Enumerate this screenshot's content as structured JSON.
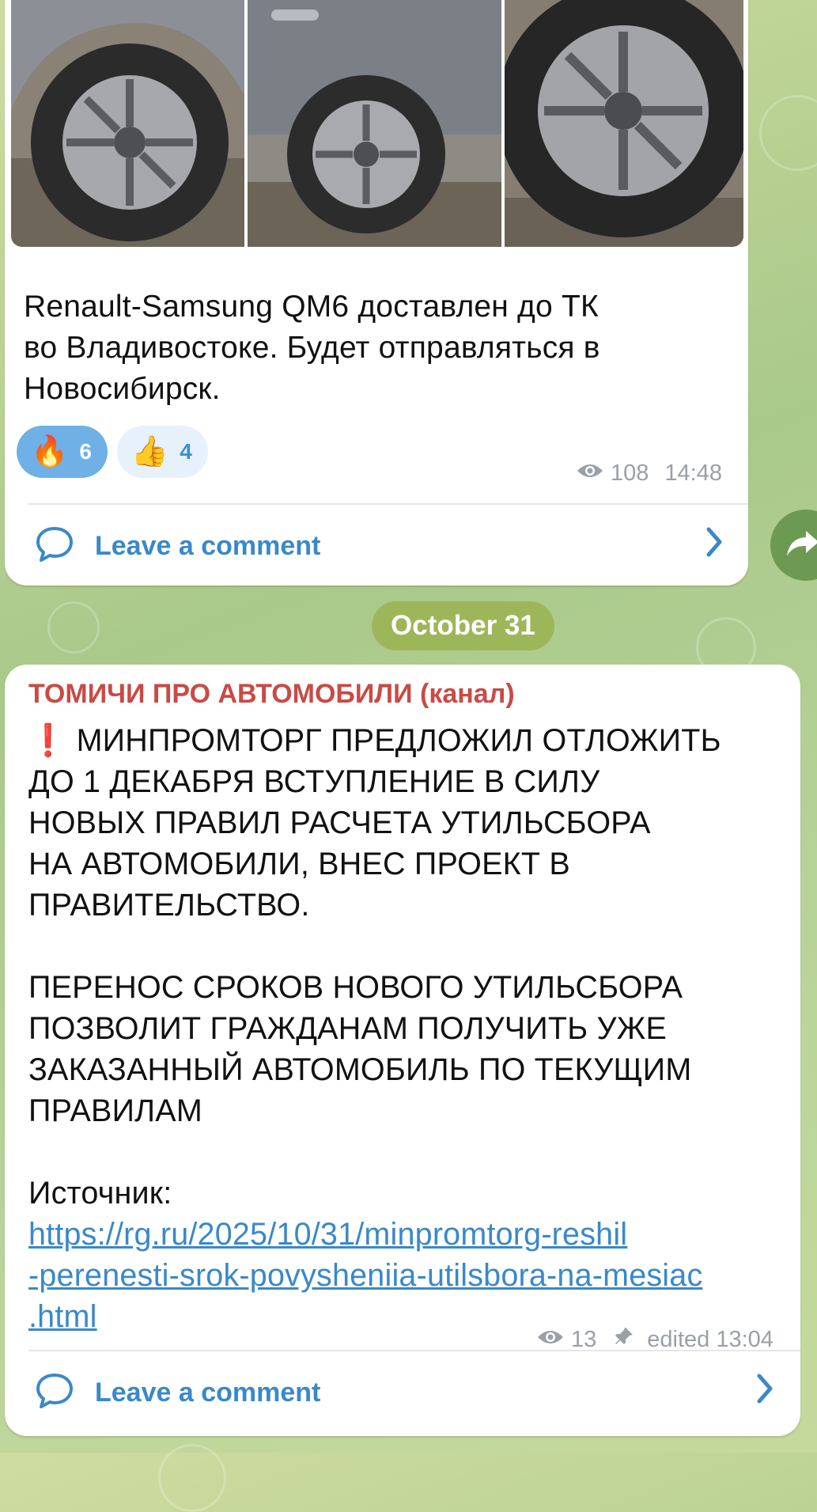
{
  "post1": {
    "text": "Renault-Samsung QM6 доставлен до ТК\nво Владивостоке. Будет отправляться в\nНовосибирск.",
    "reactions": [
      {
        "emoji": "🔥",
        "count": "6",
        "active": true
      },
      {
        "emoji": "👍",
        "count": "4",
        "active": false
      }
    ],
    "views": "108",
    "time": "14:48",
    "comment_label": "Leave a comment"
  },
  "date_separator": "October 31",
  "post2": {
    "channel_name": "ТОМИЧИ ПРО АВТОМОБИЛИ (канал)",
    "alert_icon": "❗",
    "text": " МИНПРОМТОРГ ПРЕДЛОЖИЛ ОТЛОЖИТЬ\nДО 1 ДЕКАБРЯ ВСТУПЛЕНИЕ В СИЛУ\nНОВЫХ ПРАВИЛ РАСЧЕТА УТИЛЬСБОРА\nНА АВТОМОБИЛИ, ВНЕС ПРОЕКТ В\nПРАВИТЕЛЬСТВО.\n\nПЕРЕНОС СРОКОВ НОВОГО УТИЛЬСБОРА\nПОЗВОЛИТ ГРАЖДАНАМ ПОЛУЧИТЬ УЖЕ\nЗАКАЗАННЫЙ АВТОМОБИЛЬ ПО ТЕКУЩИМ\nПРАВИЛАМ\n\nИсточник:",
    "link": "https://rg.ru/2025/10/31/minpromtorg-reshil-perenesti-srok-povysheniia-utilsbora-na-mesiac.html",
    "link_line1": "https://rg.ru/2025/10/31/minpromtorg-reshil",
    "link_line2": "-perenesti-srok-povysheniia-utilsbora-na-mesiac",
    "link_line3": ".html",
    "views": "13",
    "edited": "edited 13:04",
    "comment_label": "Leave a comment"
  },
  "colors": {
    "accent": "#3a88c9",
    "channel": "#c94a45",
    "date_pill": "#9eb65a",
    "reaction_active": "#6fb0e6"
  }
}
